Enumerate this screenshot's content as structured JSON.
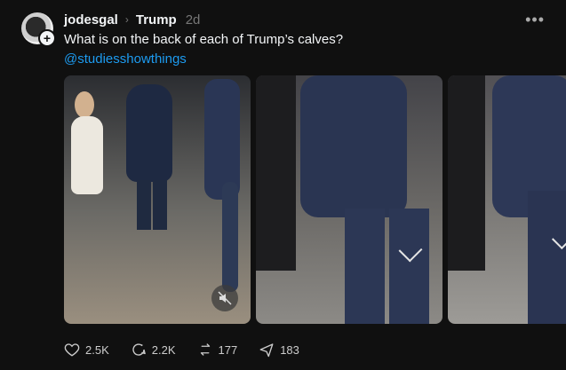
{
  "post": {
    "username": "jodesgal",
    "topic": "Trump",
    "time": "2d",
    "text": "What is on the back of each of Trump’s calves?",
    "mention": "@studiesshowthings"
  },
  "actions": {
    "likes": "2.5K",
    "replies": "2.2K",
    "reposts": "177",
    "shares": "183"
  },
  "icons": {
    "more": "more-icon",
    "mute": "mute-icon",
    "like": "heart-icon",
    "reply": "comment-icon",
    "repost": "repost-icon",
    "share": "send-icon"
  }
}
